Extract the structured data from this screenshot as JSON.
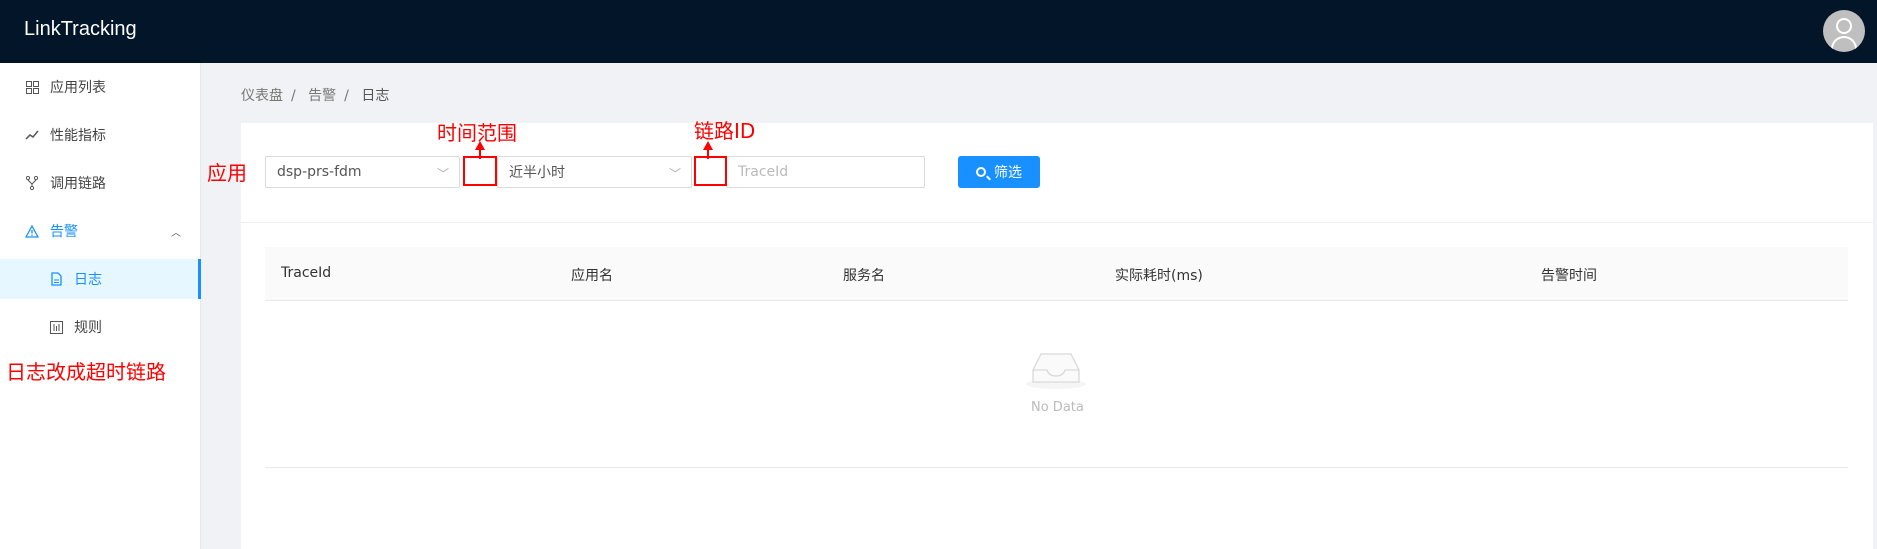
{
  "header": {
    "title": "LinkTracking"
  },
  "sidebar": {
    "items": [
      {
        "label": "应用列表",
        "icon": "grid-icon"
      },
      {
        "label": "性能指标",
        "icon": "trend-icon"
      },
      {
        "label": "调用链路",
        "icon": "branch-icon"
      },
      {
        "label": "告警",
        "icon": "warning-icon"
      },
      {
        "label": "日志",
        "icon": "file-icon"
      },
      {
        "label": "规则",
        "icon": "rule-icon"
      }
    ]
  },
  "breadcrumb": {
    "items": [
      "仪表盘",
      "告警",
      "日志"
    ],
    "separator": "/"
  },
  "filters": {
    "app_select": "dsp-prs-fdm",
    "time_select": "近半小时",
    "trace_placeholder": "TraceId",
    "filter_button": "筛选"
  },
  "table": {
    "columns": [
      "TraceId",
      "应用名",
      "服务名",
      "实际耗时(ms)",
      "告警时间"
    ],
    "empty_text": "No Data"
  },
  "annotations": {
    "app_label": "应用",
    "time_range_label": "时间范围",
    "trace_id_label": "链路ID",
    "log_note": "日志改成超时链路"
  },
  "colors": {
    "header_bg": "#021529",
    "accent": "#1890ff",
    "annotation": "#ff0000"
  }
}
